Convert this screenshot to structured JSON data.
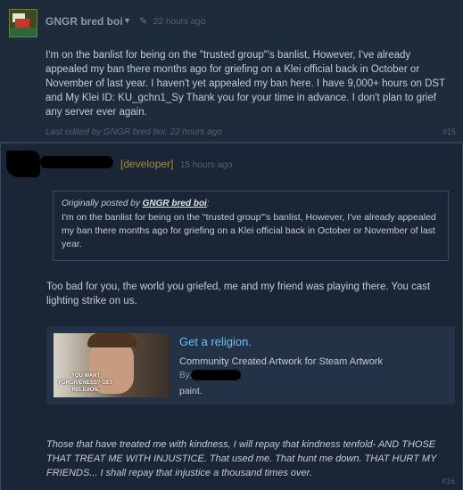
{
  "post1": {
    "author": "GNGR bred boi",
    "time": "22 hours ago",
    "body": "I'm on the banlist for being on the \"trusted group\"'s banlist, However, I've already appealed my ban there months ago for griefing on a Klei official back in October or November of last year. I haven't yet appealed my ban here. I have 9,000+ hours on DST and My Klei ID: KU_gchn1_Sy Thank you for your time in advance. I don't plan to grief any server ever again.",
    "edited": "Last edited by GNGR bred boi; 22 hours ago",
    "number": "#15"
  },
  "post2": {
    "role_tag": "[developer]",
    "time": "15 hours ago",
    "quote": {
      "prefix": "Originally posted by ",
      "author": "GNGR bred boi",
      "suffix": ":",
      "text": "I'm on the banlist for being on the \"trusted group\"'s banlist, However, I've already appealed my ban there months ago for griefing on a Klei official back in October or November of last year."
    },
    "body": "Too bad for you, the world you griefed, me and my friend was playing there. You cast lighting strike on us.",
    "embed": {
      "title": "Get a religion.",
      "subtitle": "Community Created Artwork for Steam Artwork",
      "by": "By:",
      "description": "paint.",
      "image_text": "YOU WANT FORGIVENESS? GET RELIGION."
    },
    "closing": "Those that have treated me with kindness, I will repay that kindness tenfold- AND THOSE THAT TREAT ME WITH INJUSTICE. That used me. That hunt me down. THAT HURT MY FRIENDS... I shall repay that injustice a thousand times over.",
    "number": "#16"
  },
  "colors": {
    "background": "#1b2838",
    "link": "#67c1f5",
    "developer": "#a4913a"
  }
}
